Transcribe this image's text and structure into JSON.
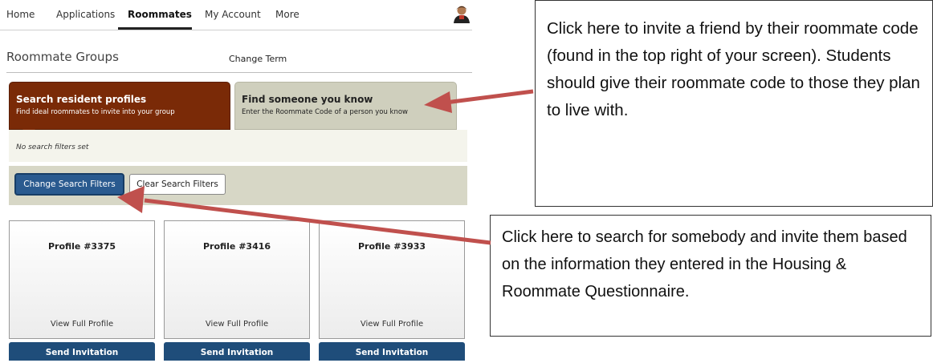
{
  "nav": {
    "items": [
      {
        "label": "Home"
      },
      {
        "label": "Applications"
      },
      {
        "label": "Roommates"
      },
      {
        "label": "My Account"
      },
      {
        "label": "More"
      }
    ]
  },
  "header": {
    "title": "Roommate Groups",
    "change_term": "Change Term"
  },
  "tabs": [
    {
      "title": "Search resident profiles",
      "subtitle": "Find ideal roommates to invite into your group"
    },
    {
      "title": "Find someone you know",
      "subtitle": "Enter the Roommate Code of a person you know"
    }
  ],
  "filters": {
    "status": "No search filters set",
    "change_label": "Change Search Filters",
    "clear_label": "Clear Search Filters"
  },
  "profiles": [
    {
      "title": "Profile #3375",
      "link": "View Full Profile",
      "action": "Send Invitation"
    },
    {
      "title": "Profile #3416",
      "link": "View Full Profile",
      "action": "Send Invitation"
    },
    {
      "title": "Profile #3933",
      "link": "View Full Profile",
      "action": "Send Invitation"
    }
  ],
  "callouts": {
    "top": "Click here to invite a friend by their roommate code (found in the top right of your screen).  Students should give their roommate code to those they plan to live with.",
    "bottom": "Click here to search for somebody and invite them based on the information they entered in the Housing & Roommate Questionnaire."
  },
  "colors": {
    "arrow": "#c0504d",
    "tab_active": "#7a2a07",
    "tab_inactive": "#cfcfbd",
    "button_primary": "#2a5a8f"
  }
}
